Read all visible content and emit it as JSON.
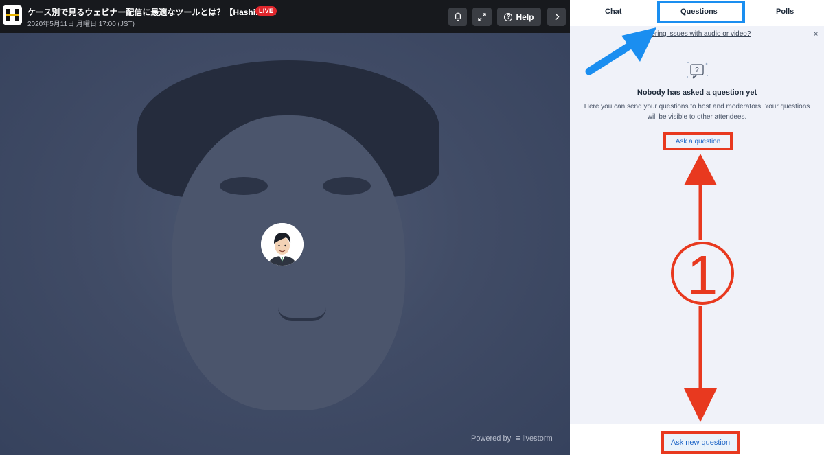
{
  "header": {
    "title": "ケース別で見るウェビナー配信に最適なツールとは？【Hashikak...",
    "live_label": "LIVE",
    "date": "2020年5月11日 月曜日 17:00 (JST)",
    "help_label": "Help",
    "icons": [
      "bell-icon",
      "expand-icon",
      "help-icon",
      "chevron-right-icon"
    ]
  },
  "video": {
    "powered_label": "Powered by",
    "brand": "livestorm"
  },
  "tabs": [
    {
      "label": "Chat"
    },
    {
      "label": "Questions",
      "active": true
    },
    {
      "label": "Polls"
    }
  ],
  "questions_panel": {
    "notice": "Encountering issues with audio or video?",
    "notice_visible": "ntering issues with audio or video?",
    "close_glyph": "×",
    "empty_title": "Nobody has asked a question yet",
    "empty_description": "Here you can send your questions to host and moderators. Your questions will be visible to other attendees.",
    "ask_button": "Ask a question",
    "ask_new_button": "Ask new question"
  },
  "annotations": {
    "step_number": "1",
    "arrow_color": "#1a8ef0",
    "highlight_color": "#e8391f"
  },
  "colors": {
    "topbar": "#17191d",
    "live": "#e0262c",
    "panel_bg": "#f0f2f9",
    "link": "#1f66c7"
  }
}
